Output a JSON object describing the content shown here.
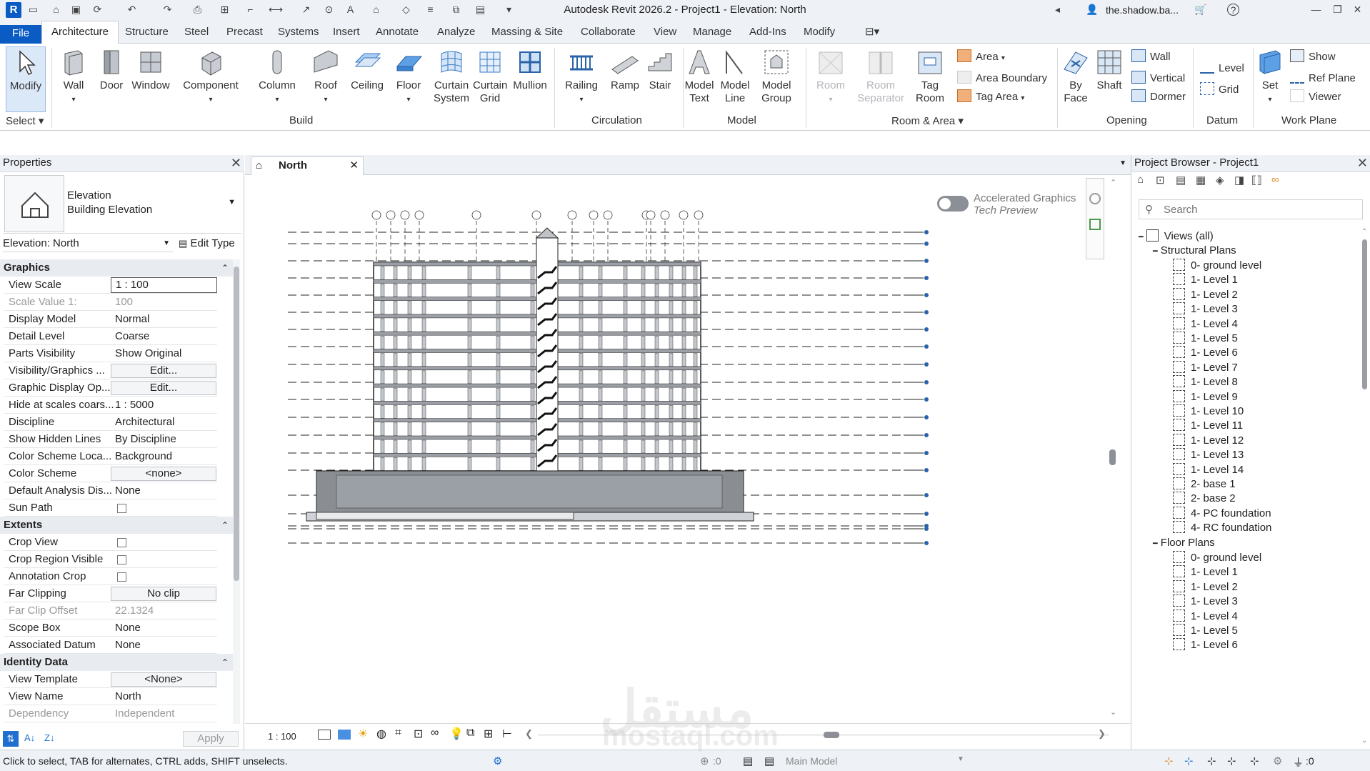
{
  "title": "Autodesk Revit 2026.2 - Project1 - Elevation: North",
  "user": "the.shadow.ba...",
  "app_letter": "R",
  "ribbon_tabs": [
    "File",
    "Architecture",
    "Structure",
    "Steel",
    "Precast",
    "Systems",
    "Insert",
    "Annotate",
    "Analyze",
    "Massing & Site",
    "Collaborate",
    "View",
    "Manage",
    "Add-Ins",
    "Modify"
  ],
  "ribbon": {
    "select": {
      "modify": "Modify",
      "select_label": "Select"
    },
    "build": {
      "label": "Build",
      "wall": "Wall",
      "door": "Door",
      "window": "Window",
      "component": "Component",
      "column": "Column",
      "roof": "Roof",
      "ceiling": "Ceiling",
      "floor": "Floor",
      "curtain_system": [
        "Curtain",
        "System"
      ],
      "curtain_grid": [
        "Curtain",
        "Grid"
      ],
      "mullion": "Mullion"
    },
    "circulation": {
      "label": "Circulation",
      "railing": "Railing",
      "ramp": "Ramp",
      "stair": "Stair"
    },
    "model": {
      "label": "Model",
      "model_text": [
        "Model",
        "Text"
      ],
      "model_line": [
        "Model",
        "Line"
      ],
      "model_group": [
        "Model",
        "Group"
      ]
    },
    "room_area": {
      "label": "Room & Area",
      "room": "Room",
      "room_separator": [
        "Room",
        "Separator"
      ],
      "tag_room": [
        "Tag",
        "Room"
      ],
      "area": "Area",
      "area_boundary": "Area  Boundary",
      "tag_area": "Tag  Area"
    },
    "opening": {
      "label": "Opening",
      "by_face": [
        "By",
        "Face"
      ],
      "shaft": "Shaft",
      "wall": "Wall",
      "vertical": "Vertical",
      "dormer": "Dormer"
    },
    "datum": {
      "label": "Datum",
      "level": "Level",
      "grid": "Grid"
    },
    "work_plane": {
      "label": "Work Plane",
      "set": "Set",
      "show": "Show",
      "ref_plane": "Ref  Plane",
      "viewer": "Viewer"
    }
  },
  "properties": {
    "header": "Properties",
    "type_name": "Elevation",
    "type_sub": "Building Elevation",
    "instance": "Elevation: North",
    "edit_type": "Edit Type",
    "groups": {
      "graphics": "Graphics",
      "extents": "Extents",
      "identity": "Identity Data"
    },
    "rows": {
      "view_scale": {
        "k": "View Scale",
        "v": "1 : 100"
      },
      "scale_value": {
        "k": "Scale Value    1:",
        "v": "100"
      },
      "display_model": {
        "k": "Display Model",
        "v": "Normal"
      },
      "detail_level": {
        "k": "Detail Level",
        "v": "Coarse"
      },
      "parts_visibility": {
        "k": "Parts Visibility",
        "v": "Show Original"
      },
      "vis_graphics": {
        "k": "Visibility/Graphics ...",
        "v": "Edit..."
      },
      "graphic_display": {
        "k": "Graphic Display Op...",
        "v": "Edit..."
      },
      "hide_scales": {
        "k": "Hide at scales coars...",
        "v": "1 : 5000"
      },
      "discipline": {
        "k": "Discipline",
        "v": "Architectural"
      },
      "hidden_lines": {
        "k": "Show Hidden Lines",
        "v": "By Discipline"
      },
      "color_loc": {
        "k": "Color Scheme Loca...",
        "v": "Background"
      },
      "color_scheme": {
        "k": "Color Scheme",
        "v": "<none>"
      },
      "default_analysis": {
        "k": "Default Analysis Dis...",
        "v": "None"
      },
      "sun_path": {
        "k": "Sun Path",
        "v": ""
      },
      "crop_view": {
        "k": "Crop View",
        "v": ""
      },
      "crop_region": {
        "k": "Crop Region Visible",
        "v": ""
      },
      "annotation_crop": {
        "k": "Annotation Crop",
        "v": ""
      },
      "far_clipping": {
        "k": "Far Clipping",
        "v": "No clip"
      },
      "far_clip_offset": {
        "k": "Far Clip Offset",
        "v": "22.1324"
      },
      "scope_box": {
        "k": "Scope Box",
        "v": "None"
      },
      "assoc_datum": {
        "k": "Associated Datum",
        "v": "None"
      },
      "view_template": {
        "k": "View Template",
        "v": "<None>"
      },
      "view_name": {
        "k": "View Name",
        "v": "North"
      },
      "dependency": {
        "k": "Dependency",
        "v": "Independent"
      }
    },
    "apply": "Apply"
  },
  "view": {
    "tab": "North",
    "accel_line1": "Accelerated Graphics",
    "accel_line2": "Tech Preview",
    "scale": "1 : 100"
  },
  "browser": {
    "header": "Project Browser - Project1",
    "search_placeholder": "Search",
    "root": "Views (all)",
    "structural_plans": "Structural Plans",
    "floor_plans": "Floor Plans",
    "structural_items": [
      "0- ground level",
      "1- Level 1",
      "1- Level 2",
      "1- Level 3",
      "1- Level 4",
      "1- Level 5",
      "1- Level 6",
      "1- Level 7",
      "1- Level 8",
      "1- Level 9",
      "1- Level 10",
      "1- Level 11",
      "1- Level 12",
      "1- Level 13",
      "1- Level 14",
      "2- base 1",
      "2- base 2",
      "4- PC foundation",
      "4- RC foundation"
    ],
    "floor_items": [
      "0- ground level",
      "1- Level 1",
      "1- Level 2",
      "1- Level 3",
      "1- Level 4",
      "1- Level 5",
      "1- Level 6"
    ]
  },
  "status": {
    "message": "Click to select, TAB for alternates, CTRL adds, SHIFT unselects.",
    "zero": ":0",
    "main_model": "Main Model",
    "filter_count": ":0"
  },
  "watermark": {
    "arabic": "مستقل",
    "latin": "mostaql.com"
  }
}
